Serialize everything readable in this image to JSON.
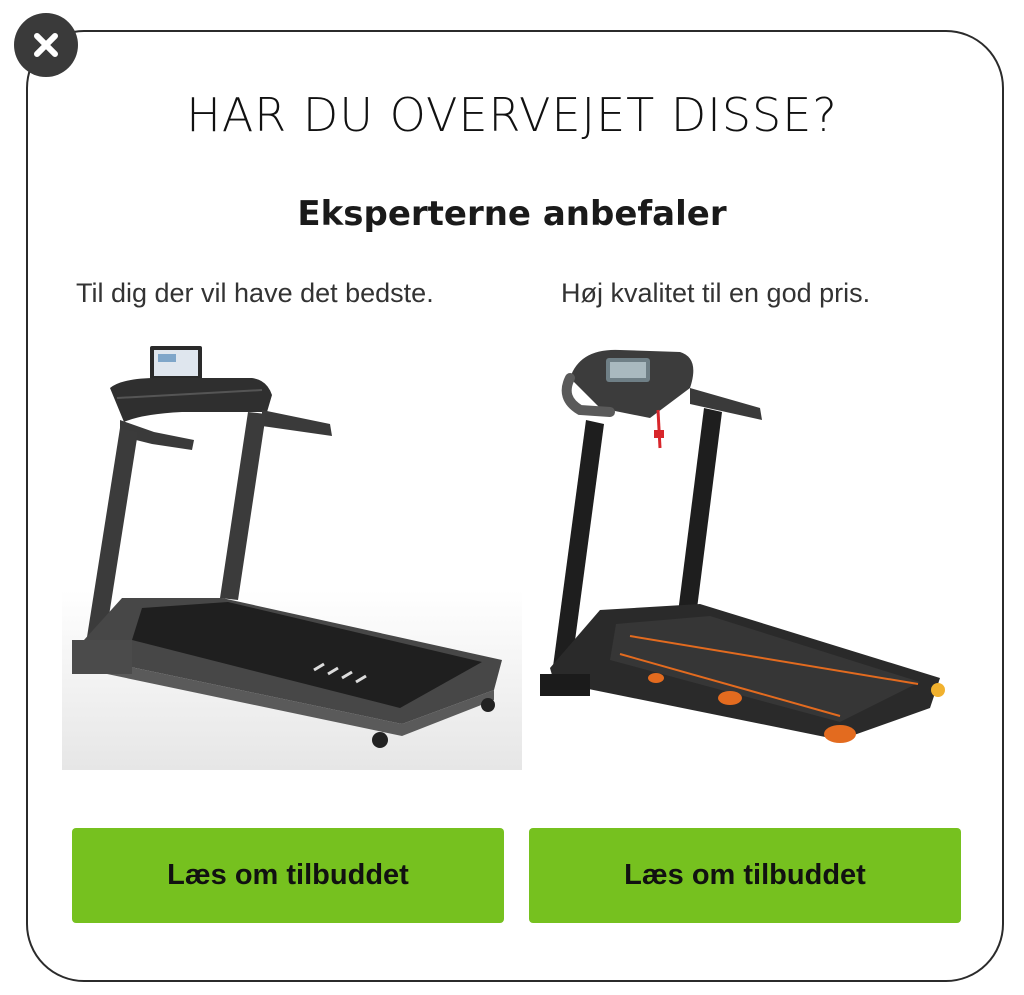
{
  "modal": {
    "headline": "HAR DU OVERVEJET DISSE?",
    "subheadline": "Eksperterne anbefaler",
    "close_icon": "close-x-icon"
  },
  "products": [
    {
      "tagline": "Til dig der vil have det bedste.",
      "cta_label": "Læs om tilbuddet",
      "image": "treadmill-premium-image"
    },
    {
      "tagline": "Høj kvalitet til en god pris.",
      "cta_label": "Læs om tilbuddet",
      "image": "treadmill-budget-image"
    }
  ],
  "colors": {
    "cta_background": "#76c11f",
    "close_background": "#3a3a3a"
  }
}
